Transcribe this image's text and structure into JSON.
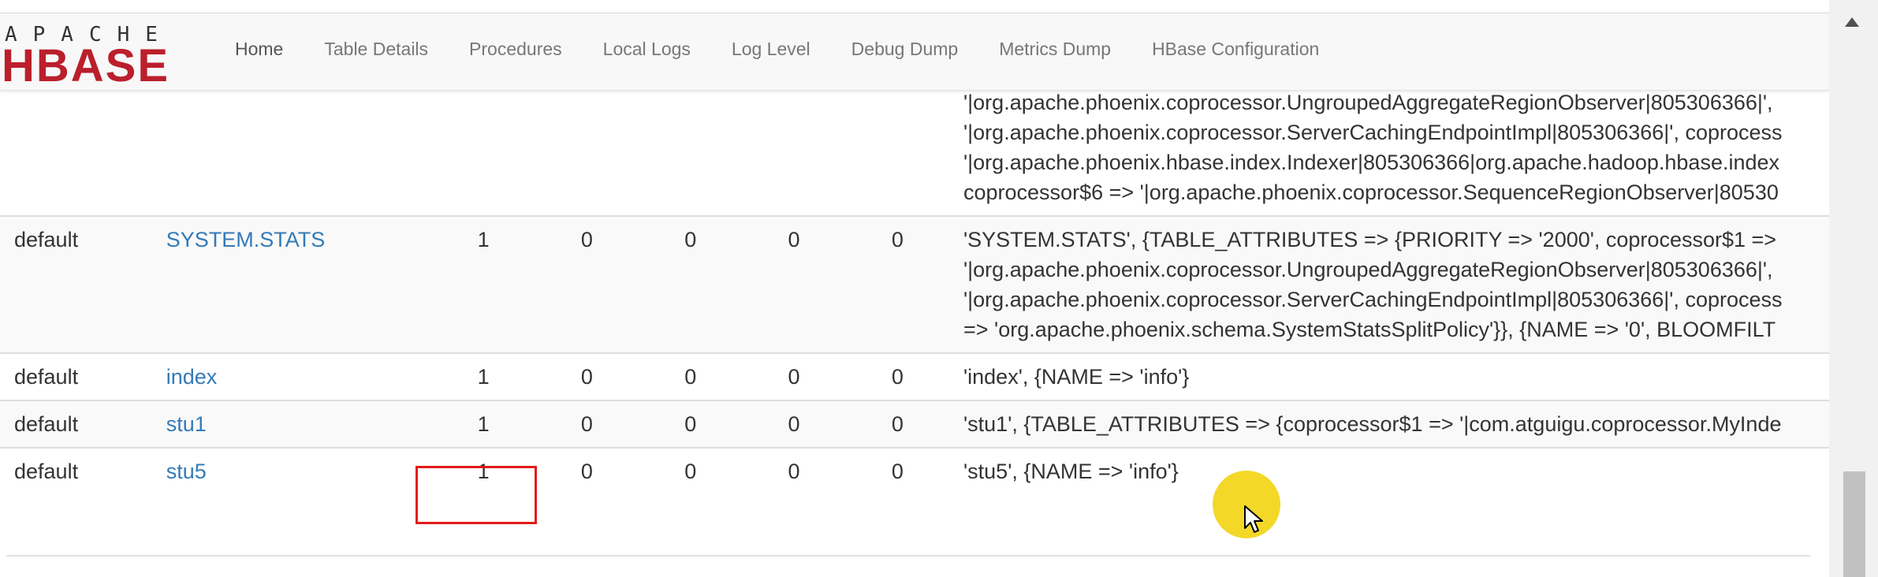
{
  "logo": {
    "top_text": "APACHE",
    "main_text": "HBASE"
  },
  "nav": {
    "items": [
      {
        "label": "Home"
      },
      {
        "label": "Table Details"
      },
      {
        "label": "Procedures"
      },
      {
        "label": "Local Logs"
      },
      {
        "label": "Log Level"
      },
      {
        "label": "Debug Dump"
      },
      {
        "label": "Metrics Dump"
      },
      {
        "label": "HBase Configuration"
      }
    ]
  },
  "partial_row": {
    "desc_lines": [
      "'|org.apache.phoenix.coprocessor.UngroupedAggregateRegionObserver|805306366|',",
      "'|org.apache.phoenix.coprocessor.ServerCachingEndpointImpl|805306366|', coprocess",
      "'|org.apache.phoenix.hbase.index.Indexer|805306366|org.apache.hadoop.hbase.index",
      "coprocessor$6 => '|org.apache.phoenix.coprocessor.SequenceRegionObserver|80530"
    ]
  },
  "rows": [
    {
      "namespace": "default",
      "name": "SYSTEM.STATS",
      "c1": "1",
      "c2": "0",
      "c3": "0",
      "c4": "0",
      "c5": "0",
      "desc_lines": [
        "'SYSTEM.STATS', {TABLE_ATTRIBUTES => {PRIORITY => '2000', coprocessor$1 =>",
        "'|org.apache.phoenix.coprocessor.UngroupedAggregateRegionObserver|805306366|',",
        "'|org.apache.phoenix.coprocessor.ServerCachingEndpointImpl|805306366|', coprocess",
        "=> 'org.apache.phoenix.schema.SystemStatsSplitPolicy'}}, {NAME => '0', BLOOMFILT"
      ]
    },
    {
      "namespace": "default",
      "name": "index",
      "c1": "1",
      "c2": "0",
      "c3": "0",
      "c4": "0",
      "c5": "0",
      "desc_lines": [
        "'index', {NAME => 'info'}"
      ]
    },
    {
      "namespace": "default",
      "name": "stu1",
      "c1": "1",
      "c2": "0",
      "c3": "0",
      "c4": "0",
      "c5": "0",
      "desc_lines": [
        "'stu1', {TABLE_ATTRIBUTES => {coprocessor$1 => '|com.atguigu.coprocessor.MyInde"
      ]
    },
    {
      "namespace": "default",
      "name": "stu5",
      "c1": "1",
      "c2": "0",
      "c3": "0",
      "c4": "0",
      "c5": "0",
      "desc_lines": [
        "'stu5', {NAME => 'info'}"
      ]
    }
  ],
  "colors": {
    "brand": "#bb1f2c",
    "link": "#337ab7",
    "highlight": "#e21b1b",
    "cursor": "#f2d411"
  }
}
